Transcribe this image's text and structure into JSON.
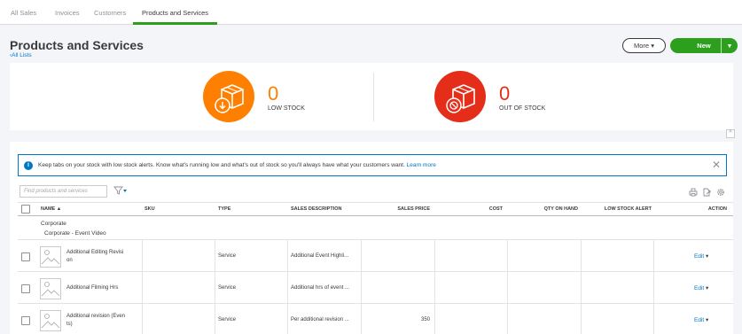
{
  "nav": {
    "tabs": [
      "All Sales",
      "Invoices",
      "Customers",
      "Products and Services"
    ],
    "active_index": 3
  },
  "header": {
    "title": "Products and Services",
    "back_link": "All Lists",
    "more_label": "More",
    "new_label": "New"
  },
  "stock": {
    "low": {
      "count": "0",
      "label": "LOW STOCK",
      "color": "#ff8000"
    },
    "out": {
      "count": "0",
      "label": "OUT OF STOCK",
      "color": "#e52e1a"
    }
  },
  "alert": {
    "text": "Keep tabs on your stock with low stock alerts. Know what's running low and what's out of stock so you'll always have what your customers want.",
    "link": "Learn more"
  },
  "search": {
    "placeholder": "Find products and services"
  },
  "table": {
    "columns": [
      "NAME ▲",
      "SKU",
      "TYPE",
      "SALES DESCRIPTION",
      "SALES PRICE",
      "COST",
      "QTY ON HAND",
      "LOW STOCK ALERT",
      "ACTION"
    ],
    "group": "Corporate",
    "subgroup": "Corporate - Event Video",
    "rows": [
      {
        "name_l1": "Additional Editing Revisi",
        "name_l2": "on",
        "sku": "",
        "type": "Service",
        "description": "Additional Event Highli...",
        "price": "",
        "cost": "",
        "qty": "",
        "alert": "",
        "action": "Edit"
      },
      {
        "name_l1": "Additional Filming Hrs",
        "name_l2": "",
        "sku": "",
        "type": "Service",
        "description": "Additional hrs of event ...",
        "price": "",
        "cost": "",
        "qty": "",
        "alert": "",
        "action": "Edit"
      },
      {
        "name_l1": "Additional revision (Even",
        "name_l2": "ts)",
        "sku": "",
        "type": "Service",
        "description": "Per additional revision ...",
        "price": "350",
        "cost": "",
        "qty": "",
        "alert": "",
        "action": "Edit"
      }
    ]
  },
  "colors": {
    "brand_green": "#2ca01c",
    "link_blue": "#0077c5"
  }
}
